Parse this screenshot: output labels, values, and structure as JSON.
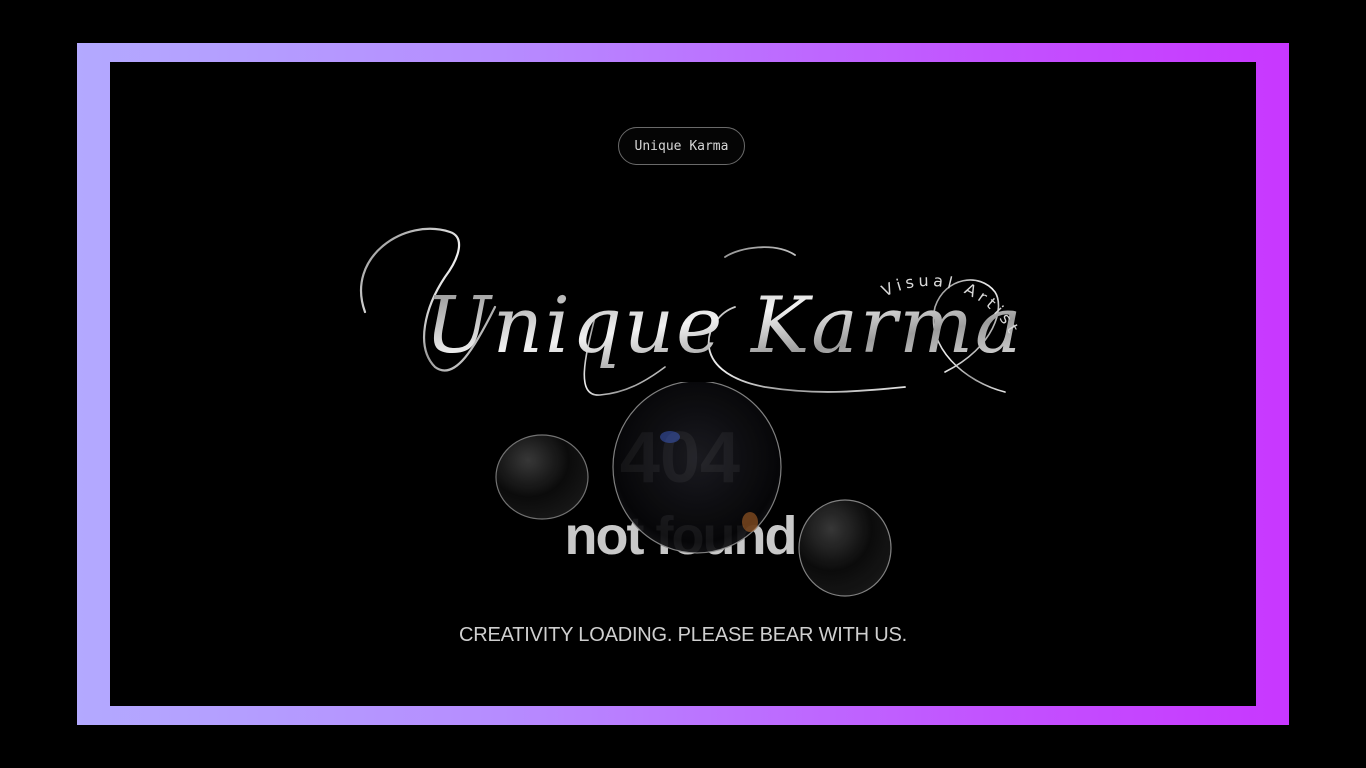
{
  "header": {
    "pill_label": "Unique Karma"
  },
  "logo": {
    "script_text": "Unique Karma",
    "arc_text": "Visual Artist"
  },
  "error_graphic": {
    "line1": "404",
    "line2": "not found"
  },
  "status": {
    "message": "CREATIVITY LOADING. PLEASE BEAR WITH US."
  },
  "colors": {
    "frame_start": "#b3a9ff",
    "frame_end": "#c837ff",
    "background": "#000000"
  }
}
